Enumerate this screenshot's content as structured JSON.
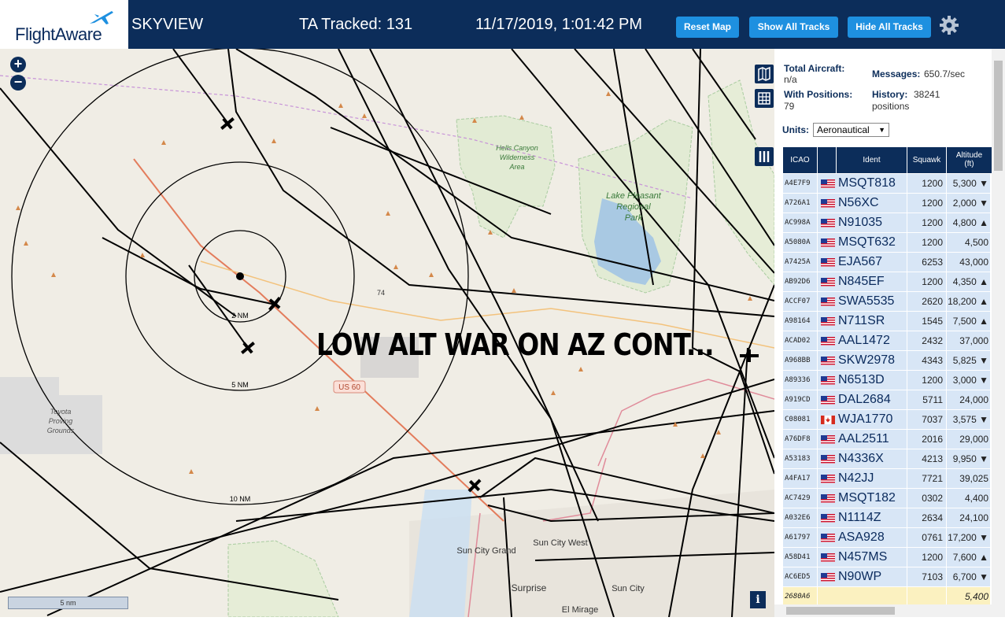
{
  "header": {
    "logo": "FlightAware",
    "app_name": "SKYVIEW",
    "tracked_label": "TA Tracked: 131",
    "datetime": "11/17/2019, 1:01:42 PM",
    "buttons": {
      "reset_map": "Reset Map",
      "show_all_tracks": "Show All Tracks",
      "hide_all_tracks": "Hide All Tracks"
    }
  },
  "map": {
    "overlay_text": "LOW ALT WAR ON AZ CONT...",
    "zoom_in": "+",
    "zoom_out": "−",
    "range_rings": [
      "2 NM",
      "5 NM",
      "10 NM"
    ],
    "labels": {
      "hells_canyon": [
        "Hells Canyon",
        "Wilderness",
        "Area"
      ],
      "lake_pleasant": [
        "Lake Pleasant",
        "Regional",
        "Park"
      ],
      "toyota": [
        "Toyota",
        "Proving",
        "Grounds"
      ],
      "us60": "US 60",
      "sun_city_grand": "Sun City Grand",
      "sun_city_west": "Sun City West",
      "surprise": "Surprise",
      "sun_city": "Sun City",
      "el_mirage": "El Mirage",
      "road_74": "74"
    },
    "scale_text": "5 nm",
    "info": "i"
  },
  "panel": {
    "total_aircraft_label": "Total Aircraft:",
    "total_aircraft_value": "n/a",
    "with_positions_label": "With Positions:",
    "with_positions_value": "79",
    "messages_label": "Messages:",
    "messages_value": "650.7/sec",
    "history_label": "History:",
    "history_value": "38241",
    "history_unit": "positions",
    "units_label": "Units:",
    "units_value": "Aeronautical",
    "columns": {
      "icao": "ICAO",
      "ident": "Ident",
      "squawk": "Squawk",
      "altitude": "Altitude",
      "altitude_unit": "(ft)"
    },
    "rows": [
      {
        "icao": "A4E7F9",
        "ident": "MSQT818",
        "squawk": "1200",
        "alt": "5,300 ▼",
        "flag": "us"
      },
      {
        "icao": "A726A1",
        "ident": "N56XC",
        "squawk": "1200",
        "alt": "2,000 ▼",
        "flag": "us"
      },
      {
        "icao": "AC998A",
        "ident": "N91035",
        "squawk": "1200",
        "alt": "4,800 ▲",
        "flag": "us"
      },
      {
        "icao": "A5080A",
        "ident": "MSQT632",
        "squawk": "1200",
        "alt": "4,500",
        "flag": "us"
      },
      {
        "icao": "A7425A",
        "ident": "EJA567",
        "squawk": "6253",
        "alt": "43,000",
        "flag": "us"
      },
      {
        "icao": "AB92D6",
        "ident": "N845EF",
        "squawk": "1200",
        "alt": "4,350 ▲",
        "flag": "us"
      },
      {
        "icao": "ACCF07",
        "ident": "SWA5535",
        "squawk": "2620",
        "alt": "18,200 ▲",
        "flag": "us"
      },
      {
        "icao": "A98164",
        "ident": "N711SR",
        "squawk": "1545",
        "alt": "7,500 ▲",
        "flag": "us"
      },
      {
        "icao": "ACAD02",
        "ident": "AAL1472",
        "squawk": "2432",
        "alt": "37,000",
        "flag": "us"
      },
      {
        "icao": "A968BB",
        "ident": "SKW2978",
        "squawk": "4343",
        "alt": "5,825 ▼",
        "flag": "us"
      },
      {
        "icao": "A89336",
        "ident": "N6513D",
        "squawk": "1200",
        "alt": "3,000 ▼",
        "flag": "us"
      },
      {
        "icao": "A919CD",
        "ident": "DAL2684",
        "squawk": "5711",
        "alt": "24,000",
        "flag": "us"
      },
      {
        "icao": "C08081",
        "ident": "WJA1770",
        "squawk": "7037",
        "alt": "3,575 ▼",
        "flag": "ca"
      },
      {
        "icao": "A76DF8",
        "ident": "AAL2511",
        "squawk": "2016",
        "alt": "29,000",
        "flag": "us"
      },
      {
        "icao": "A53183",
        "ident": "N4336X",
        "squawk": "4213",
        "alt": "9,950 ▼",
        "flag": "us"
      },
      {
        "icao": "A4FA17",
        "ident": "N42JJ",
        "squawk": "7721",
        "alt": "39,025",
        "flag": "us"
      },
      {
        "icao": "AC7429",
        "ident": "MSQT182",
        "squawk": "0302",
        "alt": "4,400",
        "flag": "us"
      },
      {
        "icao": "A032E6",
        "ident": "N1114Z",
        "squawk": "2634",
        "alt": "24,100",
        "flag": "us"
      },
      {
        "icao": "A61797",
        "ident": "ASA928",
        "squawk": "0761",
        "alt": "17,200 ▼",
        "flag": "us"
      },
      {
        "icao": "A58D41",
        "ident": "N457MS",
        "squawk": "1200",
        "alt": "7,600 ▲",
        "flag": "us"
      },
      {
        "icao": "AC6ED5",
        "ident": "N90WP",
        "squawk": "7103",
        "alt": "6,700 ▼",
        "flag": "us"
      },
      {
        "icao": "2680A6",
        "ident": "",
        "squawk": "",
        "alt": "5,400",
        "flag": "none",
        "highlight": true
      }
    ]
  },
  "colors": {
    "header_bg": "#0c2d5a",
    "button_bg": "#1e90e0",
    "row_bg": "#d8e6f6",
    "row_highlight": "#fbf1c0"
  }
}
